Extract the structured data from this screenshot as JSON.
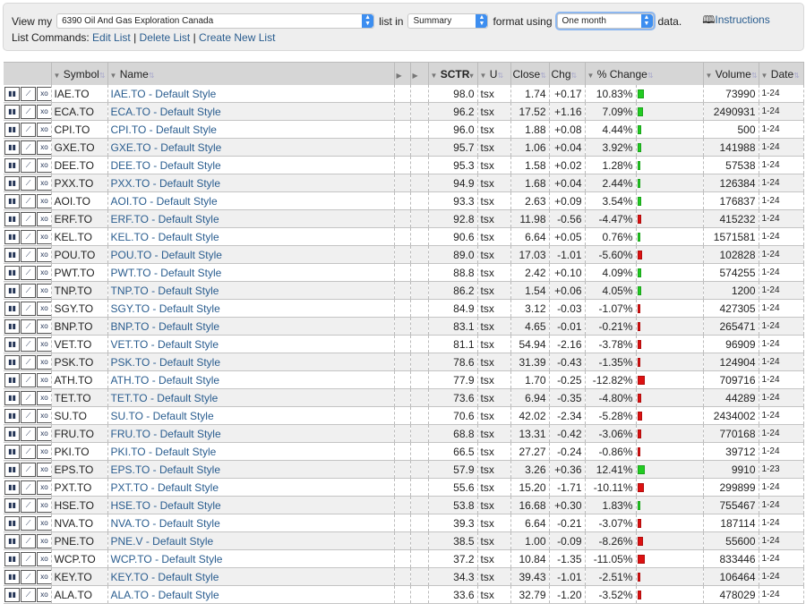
{
  "controls": {
    "view_my": "View my",
    "list": "6390 Oil And Gas Exploration Canada",
    "list_in": "list in",
    "format": "Summary",
    "format_using": "format using",
    "period": "One month",
    "data": "data.",
    "instructions": "Instructions",
    "list_commands": "List Commands:",
    "edit": "Edit List",
    "delete": "Delete List",
    "create": "Create New List"
  },
  "headers": {
    "symbol": "Symbol",
    "name": "Name",
    "sctr": "SCTR",
    "u": "U",
    "close": "Close",
    "chg": "Chg",
    "pct": "% Change",
    "volume": "Volume",
    "date": "Date"
  },
  "colors": {
    "up": "#22cc22",
    "down": "#dd1111"
  },
  "rows": [
    [
      "IAE.TO",
      "IAE.TO - Default Style",
      "98.0",
      "tsx",
      "1.74",
      "+0.17",
      "10.83%",
      "73990",
      "1-24"
    ],
    [
      "ECA.TO",
      "ECA.TO - Default Style",
      "96.2",
      "tsx",
      "17.52",
      "+1.16",
      "7.09%",
      "2490931",
      "1-24"
    ],
    [
      "CPI.TO",
      "CPI.TO - Default Style",
      "96.0",
      "tsx",
      "1.88",
      "+0.08",
      "4.44%",
      "500",
      "1-24"
    ],
    [
      "GXE.TO",
      "GXE.TO - Default Style",
      "95.7",
      "tsx",
      "1.06",
      "+0.04",
      "3.92%",
      "141988",
      "1-24"
    ],
    [
      "DEE.TO",
      "DEE.TO - Default Style",
      "95.3",
      "tsx",
      "1.58",
      "+0.02",
      "1.28%",
      "57538",
      "1-24"
    ],
    [
      "PXX.TO",
      "PXX.TO - Default Style",
      "94.9",
      "tsx",
      "1.68",
      "+0.04",
      "2.44%",
      "126384",
      "1-24"
    ],
    [
      "AOI.TO",
      "AOI.TO - Default Style",
      "93.3",
      "tsx",
      "2.63",
      "+0.09",
      "3.54%",
      "176837",
      "1-24"
    ],
    [
      "ERF.TO",
      "ERF.TO - Default Style",
      "92.8",
      "tsx",
      "11.98",
      "-0.56",
      "-4.47%",
      "415232",
      "1-24"
    ],
    [
      "KEL.TO",
      "KEL.TO - Default Style",
      "90.6",
      "tsx",
      "6.64",
      "+0.05",
      "0.76%",
      "1571581",
      "1-24"
    ],
    [
      "POU.TO",
      "POU.TO - Default Style",
      "89.0",
      "tsx",
      "17.03",
      "-1.01",
      "-5.60%",
      "102828",
      "1-24"
    ],
    [
      "PWT.TO",
      "PWT.TO - Default Style",
      "88.8",
      "tsx",
      "2.42",
      "+0.10",
      "4.09%",
      "574255",
      "1-24"
    ],
    [
      "TNP.TO",
      "TNP.TO - Default Style",
      "86.2",
      "tsx",
      "1.54",
      "+0.06",
      "4.05%",
      "1200",
      "1-24"
    ],
    [
      "SGY.TO",
      "SGY.TO - Default Style",
      "84.9",
      "tsx",
      "3.12",
      "-0.03",
      "-1.07%",
      "427305",
      "1-24"
    ],
    [
      "BNP.TO",
      "BNP.TO - Default Style",
      "83.1",
      "tsx",
      "4.65",
      "-0.01",
      "-0.21%",
      "265471",
      "1-24"
    ],
    [
      "VET.TO",
      "VET.TO - Default Style",
      "81.1",
      "tsx",
      "54.94",
      "-2.16",
      "-3.78%",
      "96909",
      "1-24"
    ],
    [
      "PSK.TO",
      "PSK.TO - Default Style",
      "78.6",
      "tsx",
      "31.39",
      "-0.43",
      "-1.35%",
      "124904",
      "1-24"
    ],
    [
      "ATH.TO",
      "ATH.TO - Default Style",
      "77.9",
      "tsx",
      "1.70",
      "-0.25",
      "-12.82%",
      "709716",
      "1-24"
    ],
    [
      "TET.TO",
      "TET.TO - Default Style",
      "73.6",
      "tsx",
      "6.94",
      "-0.35",
      "-4.80%",
      "44289",
      "1-24"
    ],
    [
      "SU.TO",
      "SU.TO - Default Style",
      "70.6",
      "tsx",
      "42.02",
      "-2.34",
      "-5.28%",
      "2434002",
      "1-24"
    ],
    [
      "FRU.TO",
      "FRU.TO - Default Style",
      "68.8",
      "tsx",
      "13.31",
      "-0.42",
      "-3.06%",
      "770168",
      "1-24"
    ],
    [
      "PKI.TO",
      "PKI.TO - Default Style",
      "66.5",
      "tsx",
      "27.27",
      "-0.24",
      "-0.86%",
      "39712",
      "1-24"
    ],
    [
      "EPS.TO",
      "EPS.TO - Default Style",
      "57.9",
      "tsx",
      "3.26",
      "+0.36",
      "12.41%",
      "9910",
      "1-23"
    ],
    [
      "PXT.TO",
      "PXT.TO - Default Style",
      "55.6",
      "tsx",
      "15.20",
      "-1.71",
      "-10.11%",
      "299899",
      "1-24"
    ],
    [
      "HSE.TO",
      "HSE.TO - Default Style",
      "53.8",
      "tsx",
      "16.68",
      "+0.30",
      "1.83%",
      "755467",
      "1-24"
    ],
    [
      "NVA.TO",
      "NVA.TO - Default Style",
      "39.3",
      "tsx",
      "6.64",
      "-0.21",
      "-3.07%",
      "187114",
      "1-24"
    ],
    [
      "PNE.TO",
      "PNE.V - Default Style",
      "38.5",
      "tsx",
      "1.00",
      "-0.09",
      "-8.26%",
      "55600",
      "1-24"
    ],
    [
      "WCP.TO",
      "WCP.TO - Default Style",
      "37.2",
      "tsx",
      "10.84",
      "-1.35",
      "-11.05%",
      "833446",
      "1-24"
    ],
    [
      "KEY.TO",
      "KEY.TO - Default Style",
      "34.3",
      "tsx",
      "39.43",
      "-1.01",
      "-2.51%",
      "106464",
      "1-24"
    ],
    [
      "ALA.TO",
      "ALA.TO - Default Style",
      "33.6",
      "tsx",
      "32.79",
      "-1.20",
      "-3.52%",
      "478029",
      "1-24"
    ]
  ]
}
